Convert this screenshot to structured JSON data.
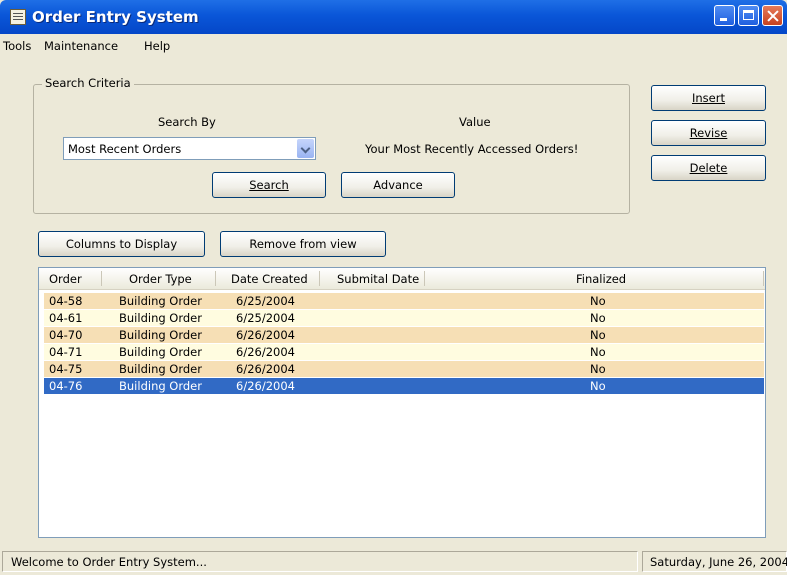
{
  "window": {
    "title": "Order Entry System"
  },
  "menu": [
    {
      "label": "Tools"
    },
    {
      "label": "Maintenance"
    },
    {
      "label": "Help"
    }
  ],
  "search": {
    "group_label": "Search Criteria",
    "search_by_label": "Search By",
    "value_label": "Value",
    "search_by_selected": "Most Recent Orders",
    "value_text": "Your Most Recently Accessed Orders!",
    "search_button": "Search",
    "advance_button": "Advance"
  },
  "actions": {
    "insert": "Insert",
    "revise": "Revise",
    "delete": "Delete"
  },
  "list_toolbar": {
    "columns_button": "Columns to Display",
    "remove_button": "Remove from view"
  },
  "table": {
    "columns": [
      "Order",
      "Order Type",
      "Date Created",
      "Submital Date",
      "Finalized"
    ],
    "rows": [
      {
        "order": "04-58",
        "type": "Building Order",
        "created": "6/25/2004",
        "submital": "",
        "finalized": "No"
      },
      {
        "order": "04-61",
        "type": "Building Order",
        "created": "6/25/2004",
        "submital": "",
        "finalized": "No"
      },
      {
        "order": "04-70",
        "type": "Building Order",
        "created": "6/26/2004",
        "submital": "",
        "finalized": "No"
      },
      {
        "order": "04-71",
        "type": "Building Order",
        "created": "6/26/2004",
        "submital": "",
        "finalized": "No"
      },
      {
        "order": "04-75",
        "type": "Building Order",
        "created": "6/26/2004",
        "submital": "",
        "finalized": "No"
      },
      {
        "order": "04-76",
        "type": "Building Order",
        "created": "6/26/2004",
        "submital": "",
        "finalized": "No"
      }
    ],
    "selected_order": "04-76"
  },
  "status": {
    "message": "Welcome to Order Entry System...",
    "date": "Saturday, June 26, 2004"
  },
  "colors": {
    "title_bar": "#0a56d8",
    "row_alt_a": "#f6dfb5",
    "row_alt_b": "#fffce0",
    "selection": "#316ac5"
  },
  "icons": {
    "app": "document-icon",
    "combo": "chevron-down-icon"
  }
}
